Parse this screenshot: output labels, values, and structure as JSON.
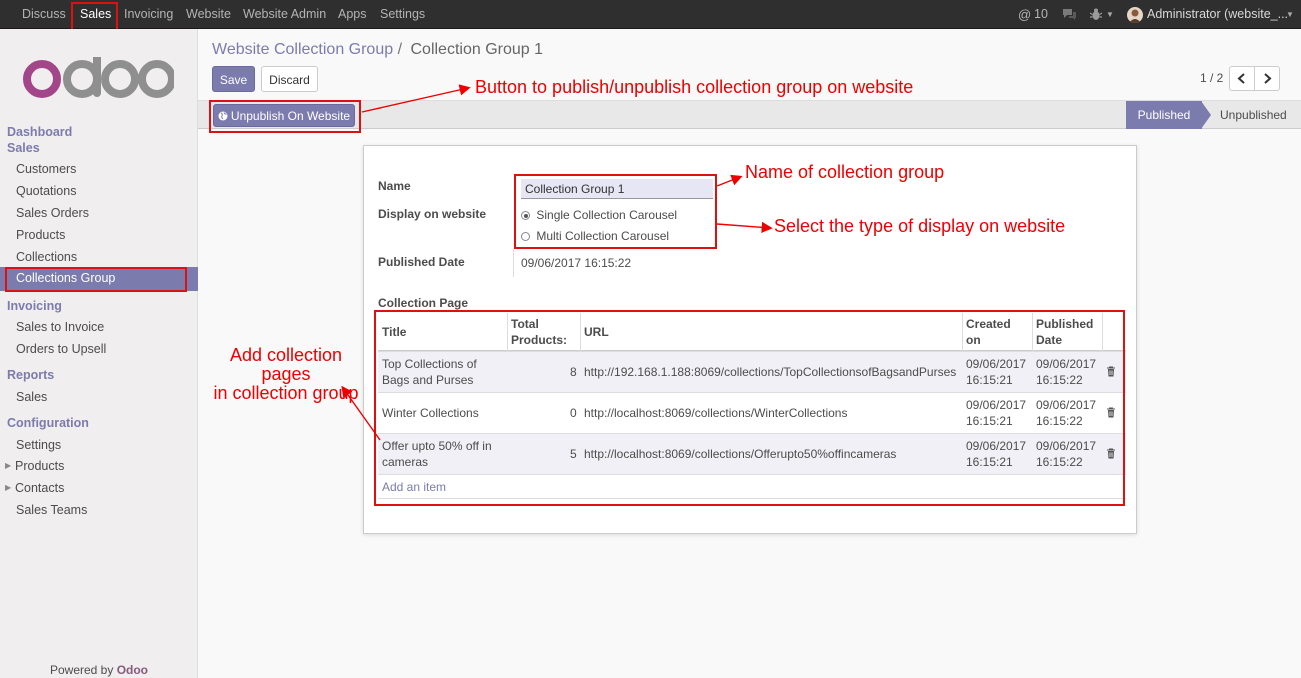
{
  "topbar": {
    "menus": [
      "Discuss",
      "Sales",
      "Invoicing",
      "Website",
      "Website Admin",
      "Apps",
      "Settings"
    ],
    "mentions": "10",
    "user": "Administrator (website_..."
  },
  "sidebar": {
    "logo": "odoo",
    "dashboard": "Dashboard",
    "sales_head": "Sales",
    "sales_items": [
      "Customers",
      "Quotations",
      "Sales Orders",
      "Products",
      "Collections",
      "Collections Group"
    ],
    "invoicing_head": "Invoicing",
    "invoicing_items": [
      "Sales to Invoice",
      "Orders to Upsell"
    ],
    "reports_head": "Reports",
    "reports_items": [
      "Sales"
    ],
    "config_head": "Configuration",
    "config_items": [
      "Settings",
      "Products",
      "Contacts",
      "Sales Teams"
    ],
    "powered_by": "Powered by",
    "powered_brand": "Odoo"
  },
  "breadcrumb": {
    "parent": "Website Collection Group",
    "separator": "/",
    "current": "Collection Group 1"
  },
  "buttons": {
    "save": "Save",
    "discard": "Discard",
    "unpublish": "Unpublish On Website"
  },
  "pager": {
    "text": "1 / 2"
  },
  "status": {
    "published": "Published",
    "unpublished": "Unpublished"
  },
  "form": {
    "name_label": "Name",
    "name_value": "Collection Group 1",
    "display_label": "Display on website",
    "display_options": [
      "Single Collection Carousel",
      "Multi Collection Carousel"
    ],
    "display_selected": "Single Collection Carousel",
    "published_date_label": "Published Date",
    "published_date_value": "09/06/2017 16:15:22",
    "collection_page_label": "Collection Page"
  },
  "table": {
    "headers": {
      "title": "Title",
      "total_1": "Total",
      "total_2": "Products:",
      "url": "URL",
      "created_1": "Created",
      "created_2": "on",
      "published_1": "Published",
      "published_2": "Date"
    },
    "rows": [
      {
        "title_1": "Top Collections of",
        "title_2": "Bags and Purses",
        "total": "8",
        "url": "http://192.168.1.188:8069/collections/TopCollectionsofBagsandPurses",
        "created_1": "09/06/2017",
        "created_2": "16:15:21",
        "published_1": "09/06/2017",
        "published_2": "16:15:22"
      },
      {
        "title_1": "Winter Collections",
        "title_2": "",
        "total": "0",
        "url": "http://localhost:8069/collections/WinterCollections",
        "created_1": "09/06/2017",
        "created_2": "16:15:21",
        "published_1": "09/06/2017",
        "published_2": "16:15:22"
      },
      {
        "title_1": "Offer upto 50% off in",
        "title_2": "cameras",
        "total": "5",
        "url": "http://localhost:8069/collections/Offerupto50%offincameras",
        "created_1": "09/06/2017",
        "created_2": "16:15:21",
        "published_1": "09/06/2017",
        "published_2": "16:15:22"
      }
    ],
    "add_item": "Add an item"
  },
  "annotations": {
    "publish_button": "Button to publish/unpublish collection group on website",
    "name": "Name of collection group",
    "display": "Select the type of display on website",
    "pages_1": "Add collection pages",
    "pages_2": "in collection group"
  },
  "colors": {
    "accent": "#7c7bad",
    "topbar": "#2f2f2f",
    "annotation": "#e00000",
    "brand": "#875a7b"
  }
}
